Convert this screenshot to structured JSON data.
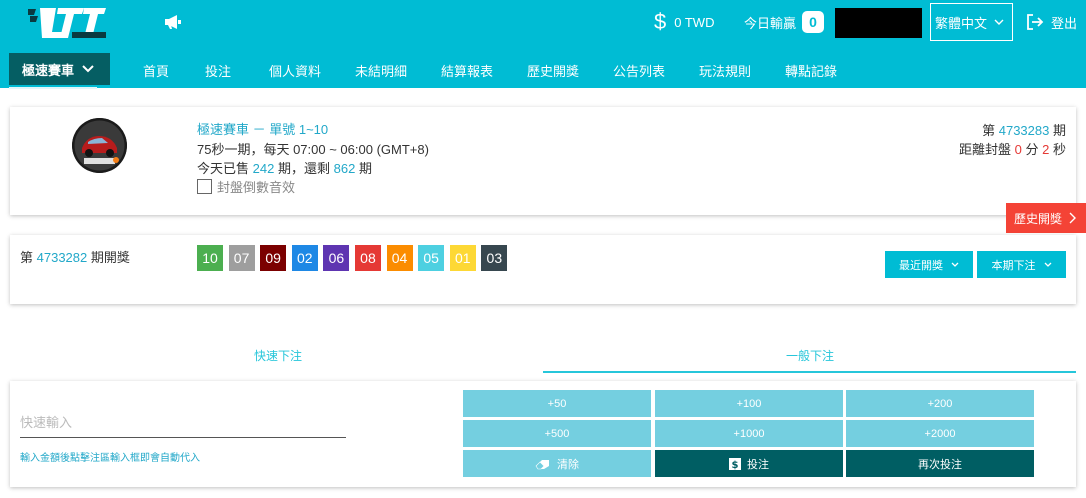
{
  "header": {
    "balance_symbol": "$",
    "balance": "0 TWD",
    "today_label": "今日輸贏",
    "today_value": "0",
    "language": "繁體中文",
    "logout": "登出"
  },
  "nav": {
    "current": "極速賽車",
    "items": [
      "首頁",
      "投注",
      "個人資料",
      "未結明細",
      "結算報表",
      "歷史開獎",
      "公告列表",
      "玩法規則",
      "轉點記錄"
    ]
  },
  "game": {
    "title": "極速賽車 － 單號 1~10",
    "schedule": "75秒一期，每天 07:00 ~ 06:00 (GMT+8)",
    "sold_prefix": "今天已售",
    "sold": "242",
    "sold_mid": "期，還剩",
    "remaining": "862",
    "sold_suffix": "期",
    "sound_label": "封盤倒數音效",
    "period_prefix": "第",
    "current_period": "4733283",
    "period_suffix": "期",
    "close_label": "距離封盤",
    "close_min": "0",
    "min_label": "分",
    "close_sec": "2",
    "sec_label": "秒"
  },
  "history_tab": "歷史開獎",
  "draw": {
    "prefix": "第",
    "period": "4733282",
    "suffix": "期開獎",
    "balls": [
      {
        "n": "10",
        "color": "#4caf50"
      },
      {
        "n": "07",
        "color": "#9e9e9e"
      },
      {
        "n": "09",
        "color": "#7b0000"
      },
      {
        "n": "02",
        "color": "#1e88e5"
      },
      {
        "n": "06",
        "color": "#5e35b1"
      },
      {
        "n": "08",
        "color": "#e53935"
      },
      {
        "n": "04",
        "color": "#fb8c00"
      },
      {
        "n": "05",
        "color": "#4dd0e1"
      },
      {
        "n": "01",
        "color": "#fdd835"
      },
      {
        "n": "03",
        "color": "#37474f"
      }
    ],
    "recent_btn": "最近開獎",
    "period_bet_btn": "本期下注"
  },
  "bet": {
    "tab_quick": "快速下注",
    "tab_general": "一般下注",
    "quick_placeholder": "快速輸入",
    "hint": "輸入金額後點擊注區輸入框即會自動代入",
    "amounts": [
      "+50",
      "+100",
      "+200",
      "+500",
      "+1000",
      "+2000"
    ],
    "clear": "清除",
    "submit": "投注",
    "rebet": "再次投注"
  },
  "colors": {
    "header_bg": "#00bcd4",
    "nav_active_bg": "#055e63",
    "accent": "#22a8c9",
    "danger": "#f44336",
    "amount_btn": "#74cfe0",
    "dark_btn": "#005e63"
  }
}
